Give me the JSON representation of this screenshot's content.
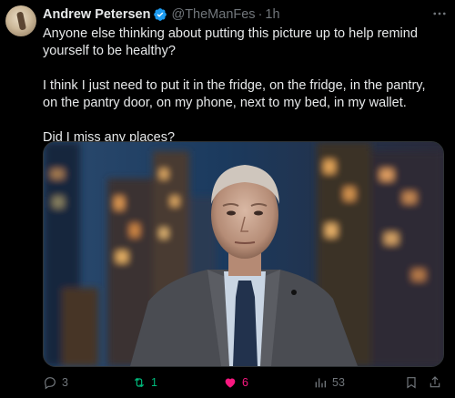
{
  "author": {
    "name": "Andrew Petersen",
    "handle": "@TheManFes",
    "time": "1h"
  },
  "body": {
    "p1": "Anyone else thinking about putting this picture up to help remind yourself to be healthy?",
    "p2": "I think I just need to put it in the fridge, on the fridge, in the pantry, on the pantry door, on my phone, next to my bed, in my wallet.",
    "p3": "Did I miss any places?"
  },
  "actions": {
    "replies": "3",
    "reposts": "1",
    "likes": "6",
    "views": "53"
  },
  "colors": {
    "background": "#000000",
    "text": "#e7e9ea",
    "muted": "#71767b",
    "verified": "#1d9bf0",
    "repost_active": "#00ba7c",
    "like_active": "#f91880"
  },
  "icons": [
    "verified-badge-icon",
    "more-icon",
    "reply-icon",
    "repost-icon",
    "like-icon",
    "views-icon",
    "bookmark-icon",
    "share-icon"
  ]
}
